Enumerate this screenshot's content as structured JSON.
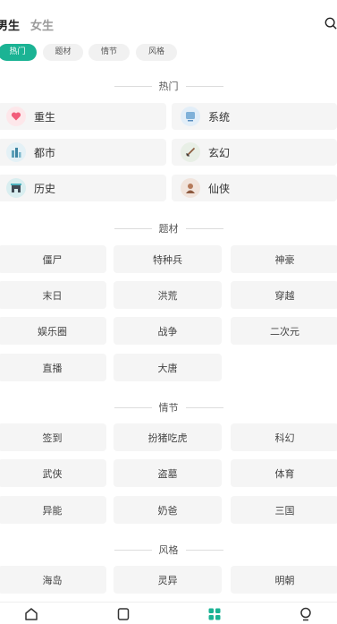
{
  "gender_tabs": {
    "male": "男生",
    "female": "女生"
  },
  "filter_chips": [
    "热门",
    "题材",
    "情节",
    "风格"
  ],
  "sections": {
    "hot": "热门",
    "theme": "题材",
    "plot": "情节",
    "style": "风格"
  },
  "hot_items": [
    "重生",
    "系统",
    "都市",
    "玄幻",
    "历史",
    "仙侠"
  ],
  "theme_items": [
    "僵尸",
    "特种兵",
    "神豪",
    "末日",
    "洪荒",
    "穿越",
    "娱乐圈",
    "战争",
    "二次元",
    "直播",
    "大唐"
  ],
  "plot_items": [
    "签到",
    "扮猪吃虎",
    "科幻",
    "武侠",
    "盗墓",
    "体育",
    "异能",
    "奶爸",
    "三国"
  ],
  "style_items": [
    "海岛",
    "灵异",
    "明朝"
  ],
  "colors": {
    "accent": "#1bb394",
    "card_bg": "#f5f5f5"
  },
  "icons": {
    "search": "search-icon",
    "nav": [
      "home-icon",
      "bookshelf-icon",
      "category-icon",
      "profile-icon"
    ]
  }
}
